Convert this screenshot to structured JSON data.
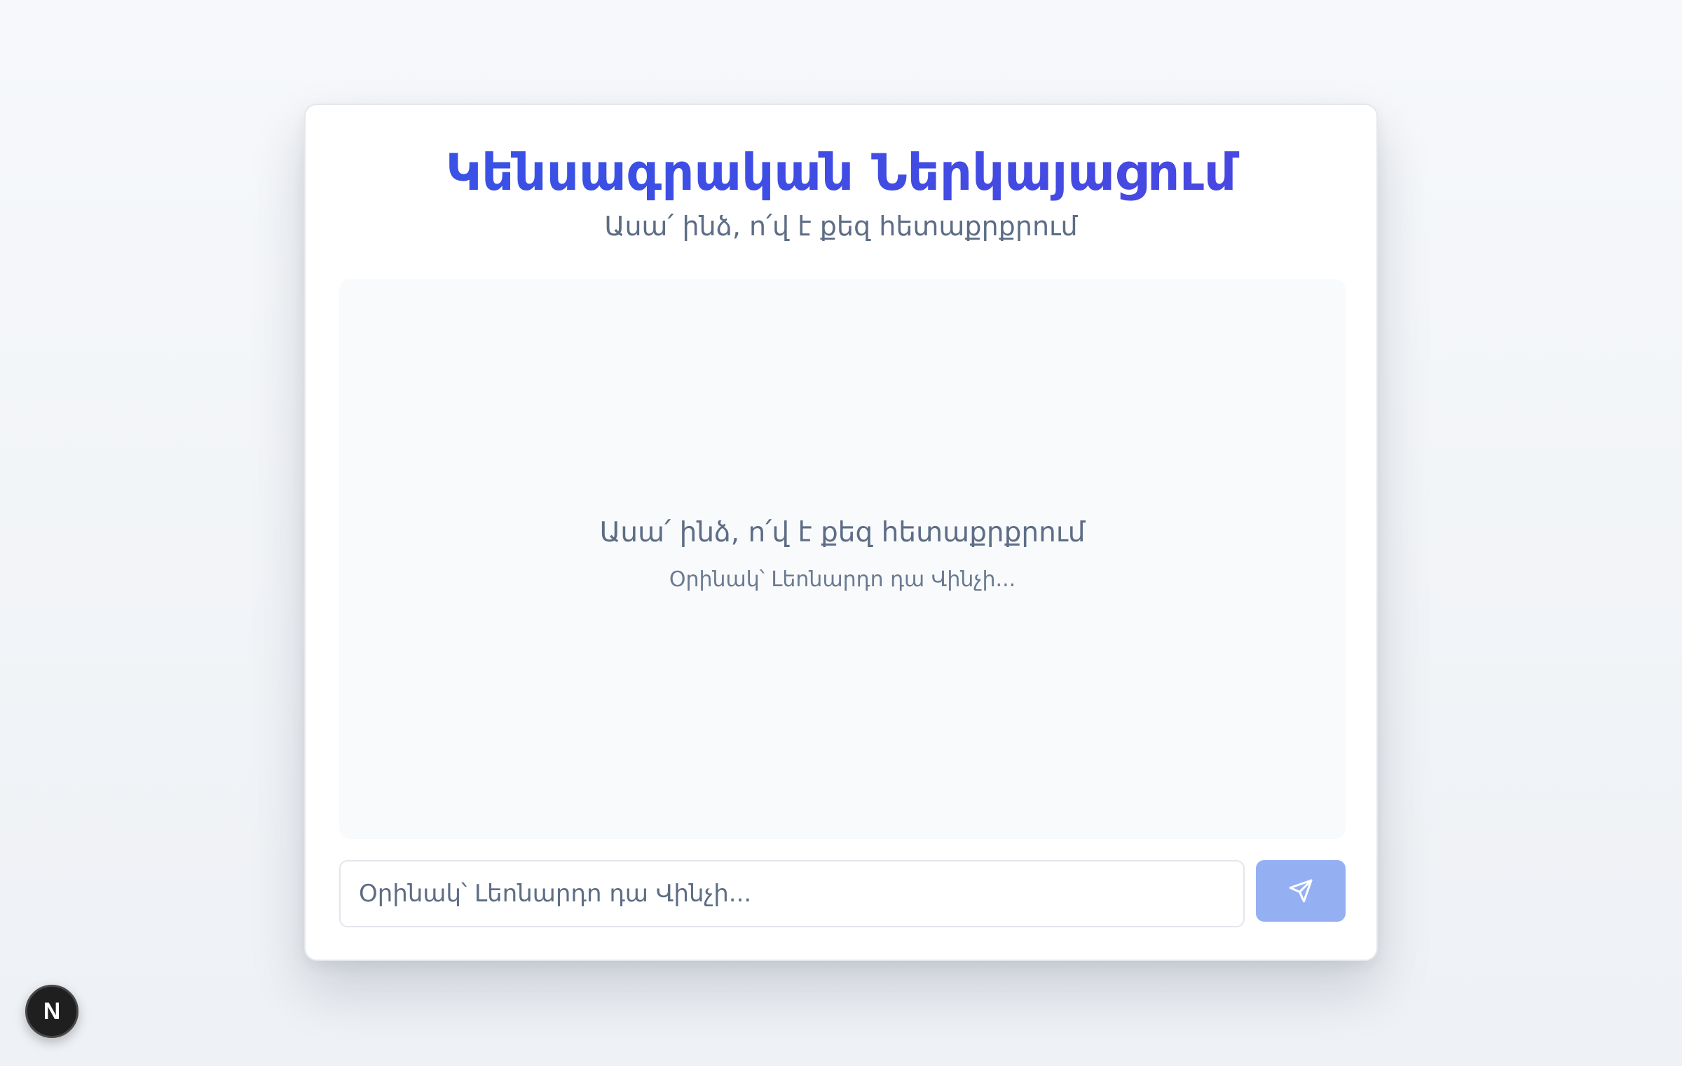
{
  "header": {
    "title": "Կենսագրական Ներկայացում",
    "subtitle": "Ասա՛ ինձ, ո՛վ է քեզ հետաքրքրում"
  },
  "chat": {
    "empty_title": "Ասա՛ ինձ, ո՛վ է քեզ հետաքրքրում",
    "empty_hint": "Օրինակ՝ Լեոնարդո դա Վինչի..."
  },
  "composer": {
    "placeholder": "Օրինակ՝ Լեոնարդո դա Վինչի...",
    "value": "",
    "send_icon": "send-icon"
  },
  "dev_badge": {
    "label": "N",
    "icon": "nextjs-logo-icon"
  },
  "colors": {
    "accent": "#3c55e2",
    "send_button_disabled": "#94b0f3",
    "chat_background": "#f8fafc",
    "text_muted": "#5d6d85"
  }
}
